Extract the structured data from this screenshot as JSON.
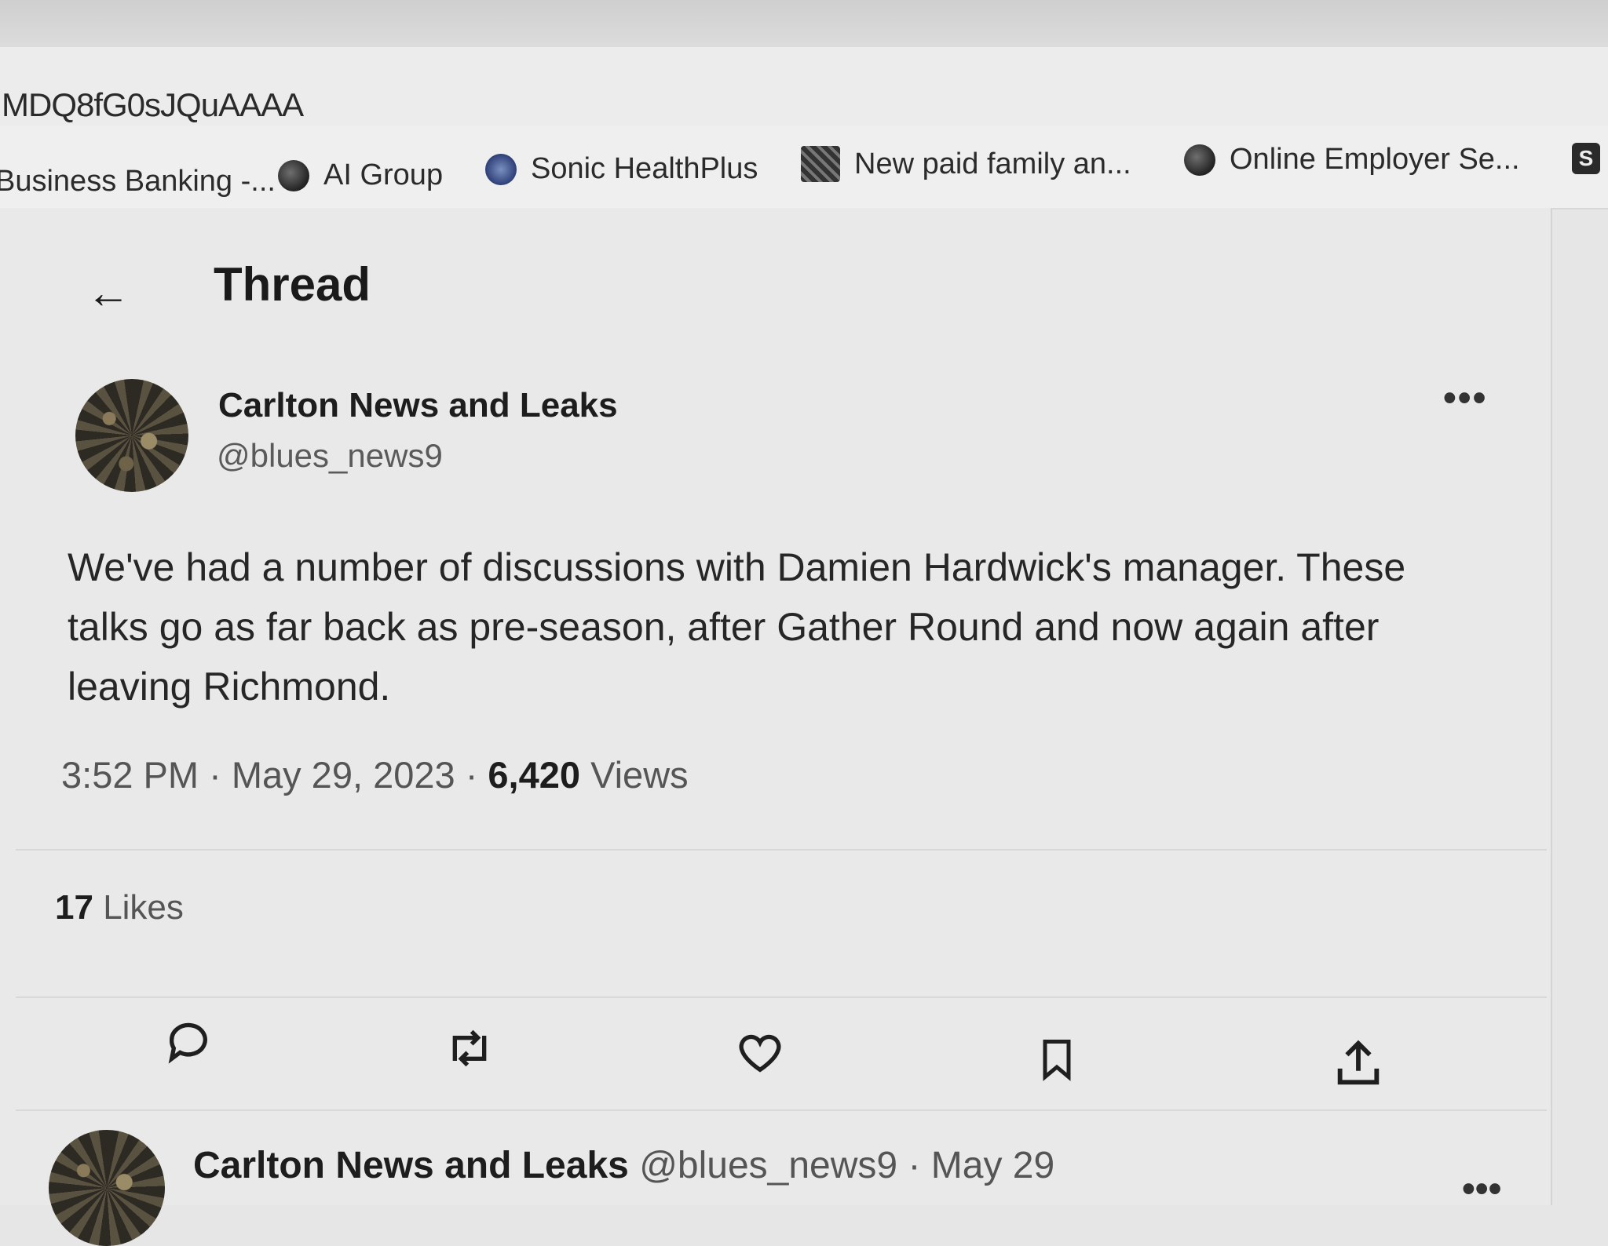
{
  "browser": {
    "url_fragment": "MDQ8fG0sJQuAAAA",
    "bookmarks": [
      {
        "label": "Business Banking -...",
        "icon": "none"
      },
      {
        "label": "AI Group",
        "icon": "globe-icon"
      },
      {
        "label": "Sonic HealthPlus",
        "icon": "sonic-logo-icon"
      },
      {
        "label": "New paid family an...",
        "icon": "site-favicon-icon"
      },
      {
        "label": "Online Employer Se...",
        "icon": "globe-icon"
      },
      {
        "label": "S",
        "icon": "sharepoint-icon"
      }
    ]
  },
  "header": {
    "back_icon": "←",
    "title": "Thread"
  },
  "tweet": {
    "display_name": "Carlton News and Leaks",
    "handle": "@blues_news9",
    "more_icon": "•••",
    "text": "We've had a number of discussions with Damien Hardwick's manager. These talks go as far back as pre-season, after Gather Round and now again after leaving Richmond.",
    "time": "3:52 PM",
    "date": "May 29, 2023",
    "views_count": "6,420",
    "views_label": "Views",
    "likes_count": "17",
    "likes_label": "Likes"
  },
  "actions": [
    {
      "name": "reply",
      "icon": "reply-icon"
    },
    {
      "name": "retweet",
      "icon": "retweet-icon"
    },
    {
      "name": "like",
      "icon": "heart-icon"
    },
    {
      "name": "bookmark",
      "icon": "bookmark-icon"
    },
    {
      "name": "share",
      "icon": "share-icon"
    }
  ],
  "reply": {
    "display_name": "Carlton News and Leaks",
    "handle": "@blues_news9",
    "separator": "·",
    "date": "May 29",
    "more_icon": "•••"
  }
}
